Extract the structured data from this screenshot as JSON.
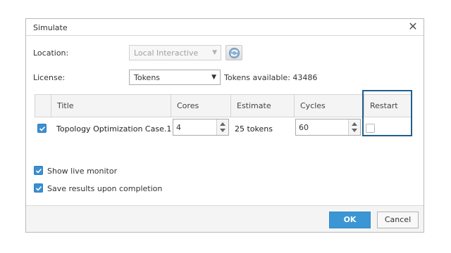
{
  "dialog": {
    "title": "Simulate",
    "close_icon": "close-icon"
  },
  "location": {
    "label": "Location:",
    "value": "Local Interactive",
    "refresh_icon": "refresh-icon"
  },
  "license": {
    "label": "License:",
    "value": "Tokens",
    "tokens_available": "Tokens available: 43486"
  },
  "table": {
    "columns": [
      "Title",
      "Cores",
      "Estimate",
      "Cycles",
      "Restart"
    ],
    "rows": [
      {
        "selected": true,
        "title": "Topology Optimization Case.1",
        "cores": "4",
        "estimate": "25 tokens",
        "cycles": "60",
        "restart": false
      }
    ]
  },
  "options": {
    "show_live_monitor": {
      "label": "Show live monitor",
      "checked": true
    },
    "save_results": {
      "label": "Save results upon completion",
      "checked": true
    }
  },
  "buttons": {
    "ok": "OK",
    "cancel": "Cancel"
  },
  "colors": {
    "accent": "#3b97d3",
    "highlight_border": "#1f5f8b",
    "checkbox_checked": "#3b8fd0"
  }
}
